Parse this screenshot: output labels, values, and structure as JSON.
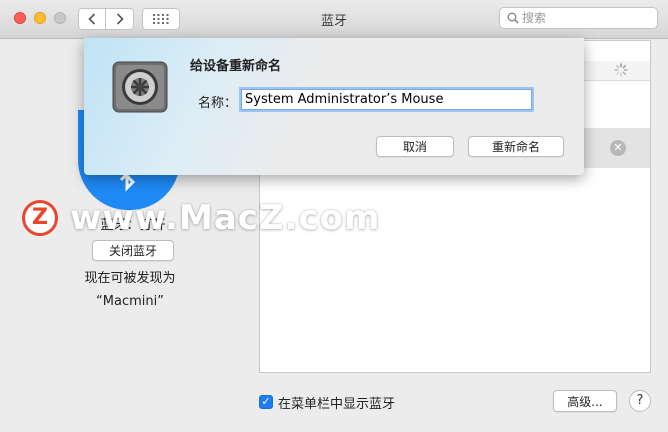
{
  "window": {
    "title": "蓝牙"
  },
  "search": {
    "placeholder": "搜索"
  },
  "left_panel": {
    "status": "蓝牙：打开",
    "toggle_button": "关闭蓝牙",
    "discoverable_text": "现在可被发现为",
    "device_name": "“Macmini”"
  },
  "dialog": {
    "title": "给设备重新命名",
    "name_label": "名称：",
    "name_value": "System Administrator’s Mouse",
    "cancel_label": "取消",
    "rename_label": "重新命名"
  },
  "bottom": {
    "show_in_menubar_label": "在菜单栏中显示蓝牙",
    "show_in_menubar_checked": true,
    "advanced_label": "高级...",
    "help_label": "?"
  },
  "watermark": {
    "logo": "Z",
    "text": "www.MacZ.com"
  },
  "colors": {
    "accent": "#1f8af5",
    "close": "#ff5f57",
    "minimize": "#ffbd2e"
  }
}
